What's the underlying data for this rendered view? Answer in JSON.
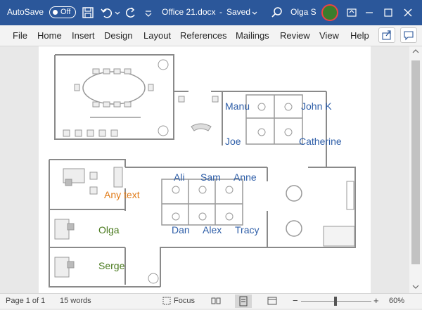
{
  "titlebar": {
    "autosave_label": "AutoSave",
    "autosave_state": "Off",
    "doc_title": "Office 21.docx",
    "saved_state": "Saved",
    "user_name": "Olga S"
  },
  "menu": {
    "items": [
      "File",
      "Home",
      "Insert",
      "Design",
      "Layout",
      "References",
      "Mailings",
      "Review",
      "View",
      "Help"
    ]
  },
  "floorplan": {
    "labels": {
      "manu": "Manu",
      "john": "John K",
      "joe": "Joe",
      "catherine": "Catherine",
      "ali": "Ali",
      "sam": "Sam",
      "anne": "Anne",
      "dan": "Dan",
      "alex": "Alex",
      "tracy": "Tracy",
      "anytext": "Any text",
      "olga": "Olga",
      "serge": "Serge"
    }
  },
  "status": {
    "page": "Page 1 of 1",
    "words": "15 words",
    "focus": "Focus",
    "zoom": "60%"
  }
}
